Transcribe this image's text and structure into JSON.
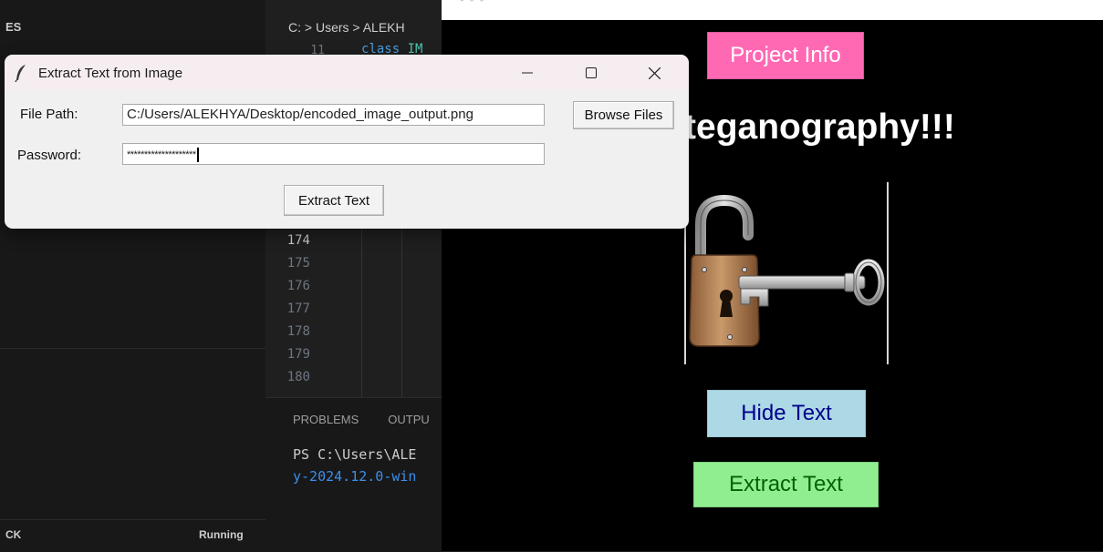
{
  "vscode": {
    "sidebar_title": "ES",
    "status_left": "CK",
    "status_right": "Running",
    "breadcrumb": "C: > Users > ALEKH",
    "code_keyword": "class",
    "code_name": "IM",
    "first_line_number": "11",
    "line_numbers": [
      "174",
      "175",
      "176",
      "177",
      "178",
      "179",
      "180"
    ],
    "panel_tabs": [
      "PROBLEMS",
      "OUTPU"
    ],
    "terminal_line1": "PS C:\\Users\\ALE",
    "terminal_line2": "y-2024.12.0-win"
  },
  "app": {
    "project_info_label": "Project Info",
    "title": "Steganography!!!",
    "lock_icon": "padlock-with-key-icon",
    "hide_text_label": "Hide Text",
    "extract_text_label": "Extract Text",
    "colors": {
      "project_info_bg": "#ff69b4",
      "hide_text_bg": "#add8e6",
      "extract_text_bg": "#90ee90"
    }
  },
  "dialog": {
    "title": "Extract Text from Image",
    "app_icon": "feather-icon",
    "file_path_label": "File Path:",
    "file_path_value": "C:/Users/ALEKHYA/Desktop/encoded_image_output.png",
    "browse_button": "Browse Files",
    "password_label": "Password:",
    "password_value": "********************",
    "extract_button": "Extract Text",
    "controls": {
      "minimize": "minimize-icon",
      "maximize": "maximize-icon",
      "close": "close-icon"
    }
  }
}
